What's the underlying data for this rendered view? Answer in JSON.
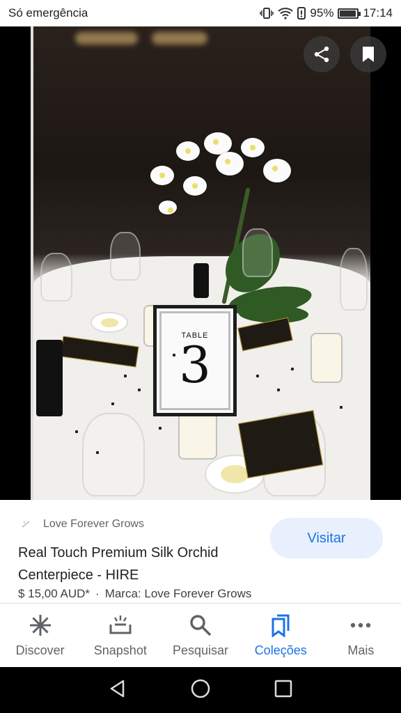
{
  "status_bar": {
    "carrier_text": "Só emergência",
    "battery_percent": "95%",
    "time": "17:14",
    "battery_level": 0.95
  },
  "viewer": {
    "actions": [
      {
        "name": "share-icon"
      },
      {
        "name": "bookmark-icon"
      }
    ],
    "photo": {
      "card_label": "TABLE",
      "card_number": "3"
    }
  },
  "product": {
    "source": "Love Forever Grows",
    "title": "Real Touch Premium Silk Orchid Centerpiece - HIRE",
    "price": "$ 15,00 AUD*",
    "separator": "·",
    "brand": "Marca: Love Forever Grows",
    "visit_label": "Visitar"
  },
  "bottom_nav": {
    "items": [
      {
        "label": "Discover",
        "icon": "asterisk-icon",
        "active": false
      },
      {
        "label": "Snapshot",
        "icon": "snapshot-icon",
        "active": false
      },
      {
        "label": "Pesquisar",
        "icon": "search-icon",
        "active": false
      },
      {
        "label": "Coleções",
        "icon": "collections-icon",
        "active": true
      },
      {
        "label": "Mais",
        "icon": "more-icon",
        "active": false
      }
    ]
  },
  "colors": {
    "accent": "#1a73e8",
    "visit_bg": "#e8f0fe",
    "text_secondary": "#5f6368"
  }
}
